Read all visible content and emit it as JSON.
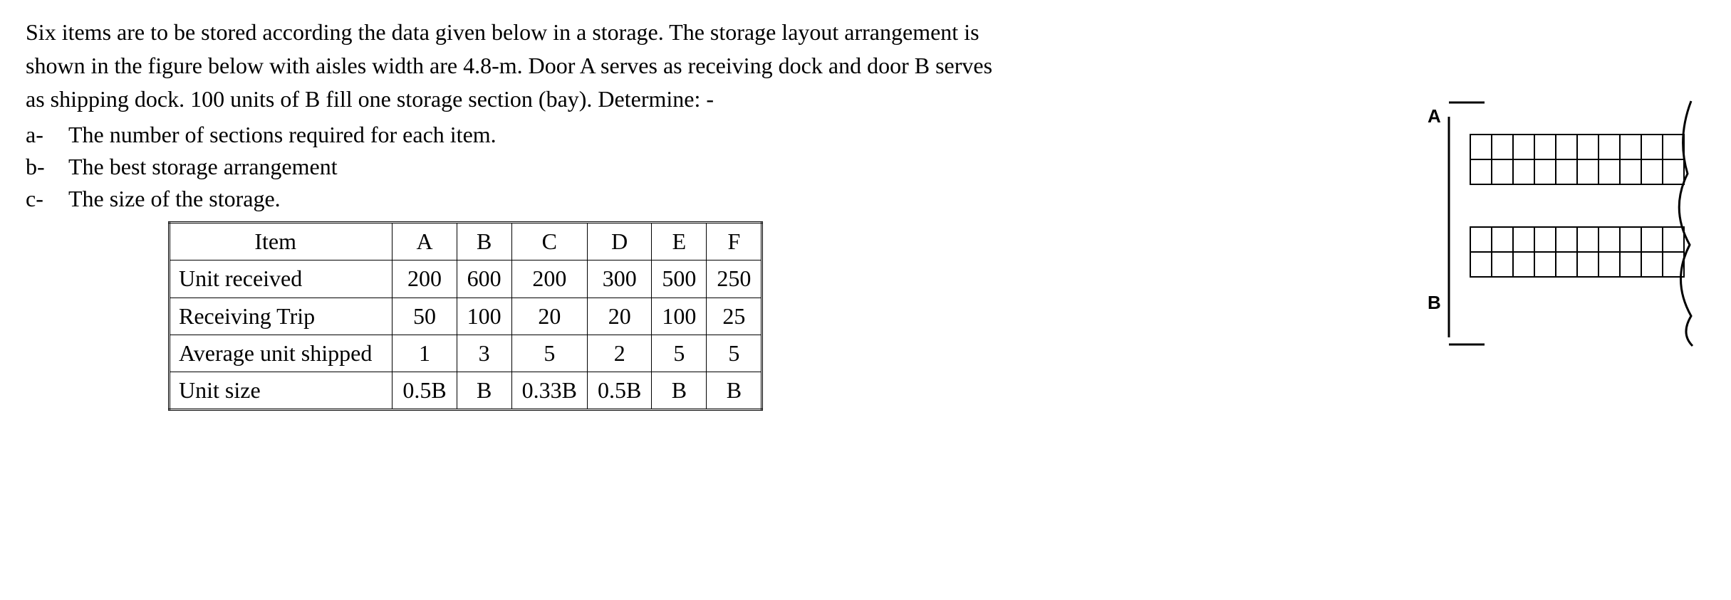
{
  "prompt": {
    "l1": "Six items are to be stored according the data given below in a storage. The storage layout arrangement is",
    "l2": "shown in the figure below with aisles width are 4.8-m. Door A serves as receiving dock and door B serves",
    "l3": "as shipping dock. 100 units of B fill one storage section (bay). Determine: -"
  },
  "questions": {
    "a_lab": "a-",
    "a": "The number of sections required for each item.",
    "b_lab": "b-",
    "b": "The best storage arrangement",
    "c_lab": "c-",
    "c": "The size of the storage."
  },
  "table": {
    "h_item": "Item",
    "cols": {
      "A": "A",
      "B": "B",
      "C": "C",
      "D": "D",
      "E": "E",
      "F": "F"
    },
    "rows": {
      "r1_label": "Unit received",
      "r1": {
        "A": "200",
        "B": "600",
        "C": "200",
        "D": "300",
        "E": "500",
        "F": "250"
      },
      "r2_label": "Receiving Trip",
      "r2": {
        "A": "50",
        "B": "100",
        "C": "20",
        "D": "20",
        "E": "100",
        "F": "25"
      },
      "r3_label": "Average unit shipped",
      "r3": {
        "A": "1",
        "B": "3",
        "C": "5",
        "D": "2",
        "E": "5",
        "F": "5"
      },
      "r4_label": "Unit size",
      "r4": {
        "A": "0.5B",
        "B": "B",
        "C": "0.33B",
        "D": "0.5B",
        "E": "B",
        "F": "B"
      }
    }
  },
  "figure": {
    "labelA": "A",
    "labelB": "B"
  },
  "chart_data": {
    "type": "table",
    "title": "Item data for six items (A–F)",
    "columns": [
      "A",
      "B",
      "C",
      "D",
      "E",
      "F"
    ],
    "rows": [
      {
        "label": "Unit received",
        "values": [
          200,
          600,
          200,
          300,
          500,
          250
        ]
      },
      {
        "label": "Receiving Trip",
        "values": [
          50,
          100,
          20,
          20,
          100,
          25
        ]
      },
      {
        "label": "Average unit shipped",
        "values": [
          1,
          3,
          5,
          2,
          5,
          5
        ]
      },
      {
        "label": "Unit size (relative to B)",
        "values": [
          0.5,
          1,
          0.33,
          0.5,
          1,
          1
        ]
      }
    ],
    "notes": {
      "aisle_width_m": 4.8,
      "door_A": "receiving dock",
      "door_B": "shipping dock",
      "units_of_B_per_bay": 100,
      "layout": "Two blocks of storage bays, each 2 rows × 10 columns, separated by a central aisle. Door A top-left, Door B bottom-left."
    }
  }
}
